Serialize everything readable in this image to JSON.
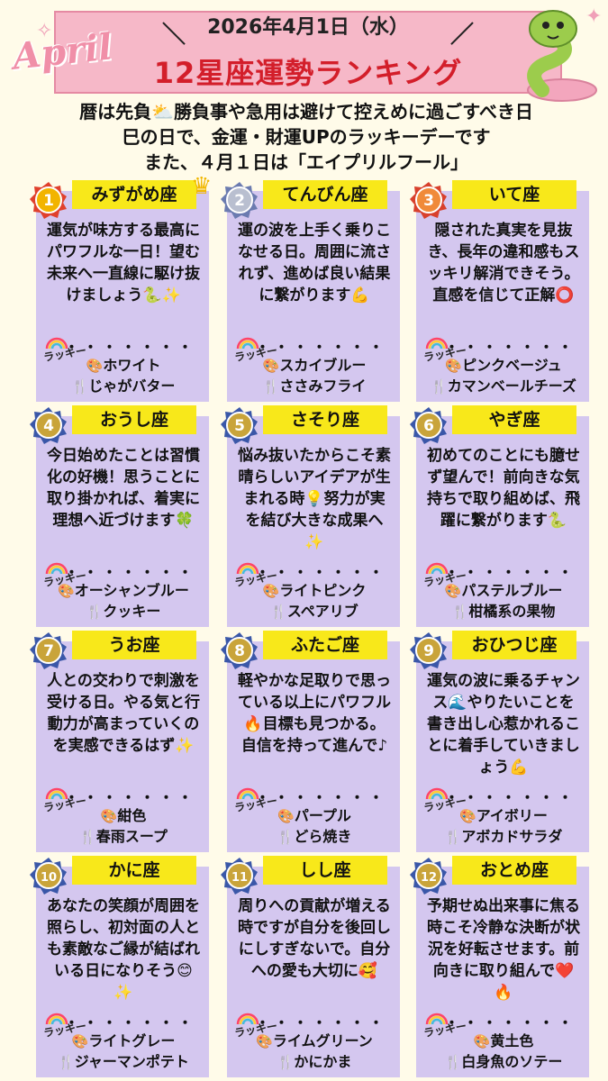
{
  "header": {
    "date": "2026年4月1日（水）",
    "month_script": "April",
    "title": "12星座運勢ランキング"
  },
  "intro": {
    "line1": "暦は先負⛅勝負事や急用は避けて控えめに過ごすべき日",
    "line2": "巳の日で、金運・財運UPのラッキーデーです",
    "line3": "また、４月１日は「エイプリルフール」"
  },
  "lucky_label": "ラッキー",
  "dots": "・・・・・・・",
  "cards": [
    {
      "rank": "1",
      "sign": "みずがめ座",
      "text": "運気が味方する最高にパワフルな一日！望む未来へ一直線に駆け抜けましょう🐍✨",
      "color": "ホワイト",
      "food": "じゃがバター"
    },
    {
      "rank": "2",
      "sign": "てんびん座",
      "text": "運の波を上手く乗りこなせる日。周囲に流されず、進めば良い結果に繋がります💪",
      "color": "スカイブルー",
      "food": "ささみフライ"
    },
    {
      "rank": "3",
      "sign": "いて座",
      "text": "隠された真実を見抜き、長年の違和感もスッキリ解消できそう。直感を信じて正解⭕",
      "color": "ピンクベージュ",
      "food": "カマンベールチーズ"
    },
    {
      "rank": "4",
      "sign": "おうし座",
      "text": "今日始めたことは習慣化の好機！思うことに取り掛かれば、着実に理想へ近づけます🍀",
      "color": "オーシャンブルー",
      "food": "クッキー"
    },
    {
      "rank": "5",
      "sign": "さそり座",
      "text": "悩み抜いたからこそ素晴らしいアイデアが生まれる時💡努力が実を結び大きな成果へ✨",
      "color": "ライトピンク",
      "food": "スペアリブ"
    },
    {
      "rank": "6",
      "sign": "やぎ座",
      "text": "初めてのことにも臆せず望んで！前向きな気持ちで取り組めば、飛躍に繋がります🐍",
      "color": "パステルブルー",
      "food": "柑橘系の果物"
    },
    {
      "rank": "7",
      "sign": "うお座",
      "text": "人との交わりで刺激を受ける日。やる気と行動力が高まっていくのを実感できるはず✨",
      "color": "紺色",
      "food": "春雨スープ"
    },
    {
      "rank": "8",
      "sign": "ふたご座",
      "text": "軽やかな足取りで思っている以上にパワフル🔥目標も見つかる。自信を持って進んで♪",
      "color": "パープル",
      "food": "どら焼き"
    },
    {
      "rank": "9",
      "sign": "おひつじ座",
      "text": "運気の波に乗るチャンス🌊やりたいことを書き出し心惹かれることに着手していきましょう💪",
      "color": "アイボリー",
      "food": "アボカドサラダ"
    },
    {
      "rank": "10",
      "sign": "かに座",
      "text": "あなたの笑顔が周囲を照らし、初対面の人とも素敵なご縁が結ばれいる日になりそう😊✨",
      "color": "ライトグレー",
      "food": "ジャーマンポテト"
    },
    {
      "rank": "11",
      "sign": "しし座",
      "text": "周りへの貢献が増える時ですが自分を後回しにしすぎないで。自分への愛も大切に🥰",
      "color": "ライムグリーン",
      "food": "かにかま"
    },
    {
      "rank": "12",
      "sign": "おとめ座",
      "text": "予期せぬ出来事に焦る時こそ冷静な決断が状況を好転させます。前向きに取り組んで❤️🔥",
      "color": "黄土色",
      "food": "白身魚のソテー"
    }
  ]
}
